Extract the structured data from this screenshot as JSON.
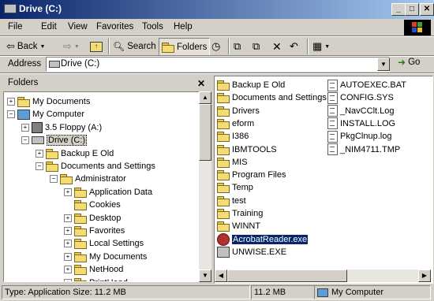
{
  "window": {
    "title": "Drive (C:)"
  },
  "menu": [
    "File",
    "Edit",
    "View",
    "Favorites",
    "Tools",
    "Help"
  ],
  "toolbar": {
    "back": "Back",
    "search": "Search",
    "folders": "Folders"
  },
  "address": {
    "label": "Address",
    "value": "Drive (C:)",
    "go": "Go"
  },
  "folders_pane": {
    "title": "Folders",
    "tree": [
      {
        "label": "My Documents",
        "icon": "my-documents-icon",
        "level": 0,
        "expander": "+"
      },
      {
        "label": "My Computer",
        "icon": "computer-icon",
        "level": 0,
        "expander": "-"
      },
      {
        "label": "3.5 Floppy (A:)",
        "icon": "floppy-icon",
        "level": 1,
        "expander": "+"
      },
      {
        "label": "Drive (C:)",
        "icon": "drive-icon",
        "level": 1,
        "expander": "-",
        "selected": true
      },
      {
        "label": "Backup E Old",
        "icon": "folder-icon",
        "level": 2,
        "expander": "+"
      },
      {
        "label": "Documents and Settings",
        "icon": "folder-icon",
        "level": 2,
        "expander": "-"
      },
      {
        "label": "Administrator",
        "icon": "folder-icon",
        "level": 3,
        "expander": "-"
      },
      {
        "label": "Application Data",
        "icon": "folder-icon",
        "level": 4,
        "expander": "+"
      },
      {
        "label": "Cookies",
        "icon": "folder-icon",
        "level": 4,
        "expander": ""
      },
      {
        "label": "Desktop",
        "icon": "folder-icon",
        "level": 4,
        "expander": "+"
      },
      {
        "label": "Favorites",
        "icon": "favorites-folder-icon",
        "level": 4,
        "expander": "+"
      },
      {
        "label": "Local Settings",
        "icon": "folder-icon",
        "level": 4,
        "expander": "+"
      },
      {
        "label": "My Documents",
        "icon": "folder-icon",
        "level": 4,
        "expander": "+"
      },
      {
        "label": "NetHood",
        "icon": "folder-icon",
        "level": 4,
        "expander": "+"
      },
      {
        "label": "PrintHood",
        "icon": "folder-icon",
        "level": 4,
        "expander": "+"
      }
    ]
  },
  "files": {
    "col1": [
      {
        "label": "Backup E Old",
        "icon": "folder-icon"
      },
      {
        "label": "Documents and Settings",
        "icon": "folder-icon"
      },
      {
        "label": "Drivers",
        "icon": "folder-icon"
      },
      {
        "label": "eform",
        "icon": "folder-icon"
      },
      {
        "label": "I386",
        "icon": "folder-icon"
      },
      {
        "label": "IBMTOOLS",
        "icon": "folder-icon"
      },
      {
        "label": "MIS",
        "icon": "folder-icon"
      },
      {
        "label": "Program Files",
        "icon": "folder-icon"
      },
      {
        "label": "Temp",
        "icon": "folder-icon"
      },
      {
        "label": "test",
        "icon": "folder-icon"
      },
      {
        "label": "Training",
        "icon": "folder-icon"
      },
      {
        "label": "WINNT",
        "icon": "folder-icon"
      },
      {
        "label": "AcrobatReader.exe",
        "icon": "acrobat-icon",
        "selected": true
      },
      {
        "label": "UNWISE.EXE",
        "icon": "exe-icon"
      }
    ],
    "col2": [
      {
        "label": "AUTOEXEC.BAT",
        "icon": "document-icon"
      },
      {
        "label": "CONFIG.SYS",
        "icon": "document-icon"
      },
      {
        "label": "_NavCClt.Log",
        "icon": "document-icon"
      },
      {
        "label": "INSTALL.LOG",
        "icon": "document-icon"
      },
      {
        "label": "PkgClnup.log",
        "icon": "document-icon"
      },
      {
        "label": "_NIM4711.TMP",
        "icon": "document-icon"
      }
    ]
  },
  "status": {
    "info": "Type: Application Size: 11.2 MB",
    "size": "11.2 MB",
    "zone": "My Computer"
  }
}
